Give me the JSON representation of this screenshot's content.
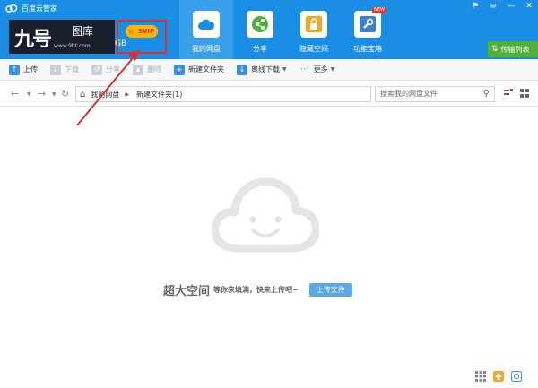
{
  "app": {
    "title": "百度云管家"
  },
  "window_controls": [
    "bell-icon",
    "menu-icon",
    "minimize-icon",
    "close-icon"
  ],
  "watermark": {
    "logo_text": "九号",
    "site_name": "图库",
    "url": "www.9ht.com"
  },
  "account": {
    "quota_fragment": "GB",
    "badge": "SVIP"
  },
  "nav": [
    {
      "label": "我的网盘",
      "icon": "cloud-disk-icon",
      "active": true
    },
    {
      "label": "分享",
      "icon": "share-icon",
      "active": false
    },
    {
      "label": "隐藏空间",
      "icon": "lock-icon",
      "active": false
    },
    {
      "label": "功能宝箱",
      "icon": "toolbox-icon",
      "active": false,
      "tag": "NEW"
    }
  ],
  "transfer_list": "传输列表",
  "toolbar": {
    "upload": "上传",
    "download": "下载",
    "share": "分享",
    "delete": "删除",
    "new_folder": "新建文件夹",
    "offline_download": "离线下载",
    "more": "更多"
  },
  "breadcrumb": [
    "我的网盘",
    "新建文件夹(1)"
  ],
  "search": {
    "placeholder": "搜索我的网盘文件"
  },
  "empty_state": {
    "headline": "超大空间",
    "subtext": "等你来填满，快来上传吧~",
    "button": "上传文件"
  },
  "colors": {
    "header": "#1a8ee5",
    "active_nav": "#3ba0ec",
    "transfer_button": "#4fb13a",
    "annotation": "#d9312e",
    "upload_button": "#5aa9e6"
  }
}
